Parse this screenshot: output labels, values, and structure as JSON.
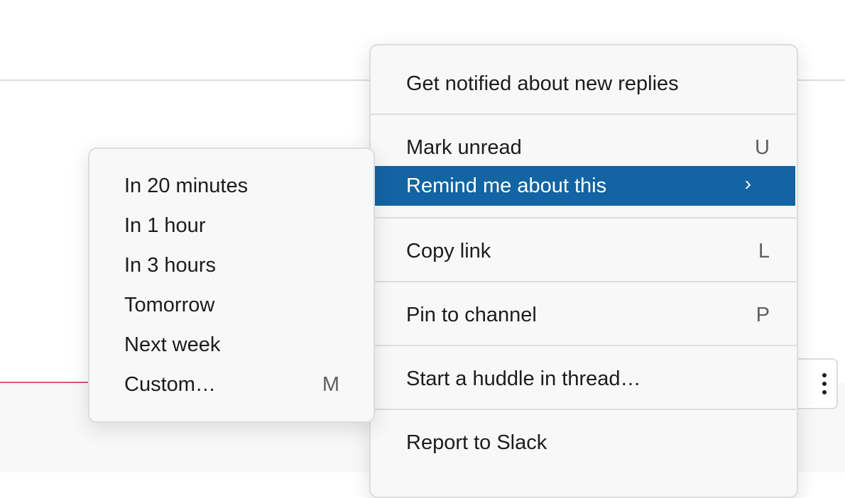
{
  "main_menu": {
    "items": [
      {
        "label": "Get notified about new replies",
        "shortcut": ""
      },
      {
        "label": "Mark unread",
        "shortcut": "U"
      },
      {
        "label": "Remind me about this",
        "shortcut": "›"
      },
      {
        "label": "Copy link",
        "shortcut": "L"
      },
      {
        "label": "Pin to channel",
        "shortcut": "P"
      },
      {
        "label": "Start a huddle in thread…",
        "shortcut": ""
      },
      {
        "label": "Report to Slack",
        "shortcut": ""
      }
    ],
    "highlight_color": "#1264a3"
  },
  "submenu": {
    "items": [
      {
        "label": "In 20 minutes",
        "shortcut": ""
      },
      {
        "label": "In 1 hour",
        "shortcut": ""
      },
      {
        "label": "In 3 hours",
        "shortcut": ""
      },
      {
        "label": "Tomorrow",
        "shortcut": ""
      },
      {
        "label": "Next week",
        "shortcut": ""
      },
      {
        "label": "Custom…",
        "shortcut": "M"
      }
    ]
  },
  "more_actions": {
    "icon": "vertical-ellipsis-icon"
  },
  "colors": {
    "new_message_line": "#e8547a",
    "menu_background": "#f8f8f8",
    "border": "#dddddd"
  }
}
